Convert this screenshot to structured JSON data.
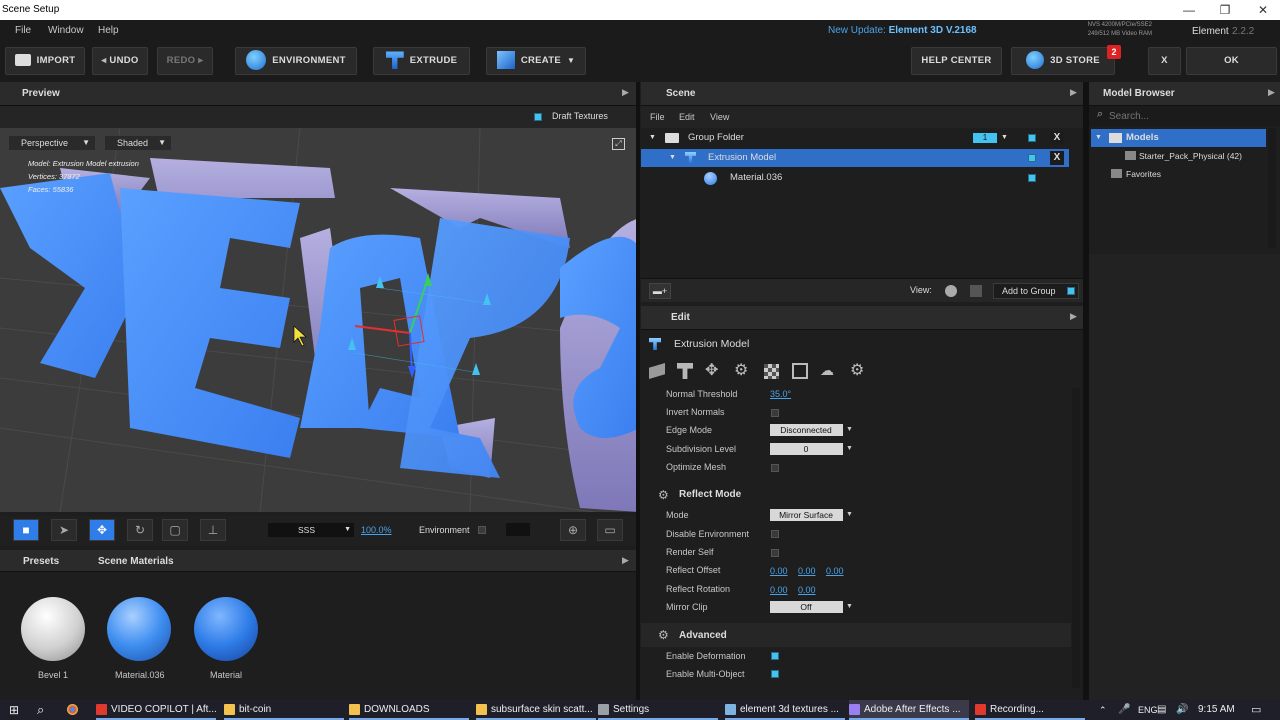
{
  "window": {
    "title": "Scene Setup",
    "controls": {
      "minimize": "—",
      "restore": "❐",
      "close": "✕"
    }
  },
  "menu": [
    "File",
    "Window",
    "Help"
  ],
  "update_prefix": "New Update:",
  "update_version": "Element 3D V.2168",
  "gpu_info": {
    "line1": "NVS 4200M/PCIe/SSE2",
    "line2": "249/512 MB Video RAM"
  },
  "app_name": "Element",
  "app_version": "2.2.2",
  "toolbar": {
    "import": "IMPORT",
    "undo": "UNDO",
    "redo": "REDO",
    "environment": "ENVIRONMENT",
    "extrude": "EXTRUDE",
    "create": "CREATE",
    "help_center": "HELP CENTER",
    "store": "3D STORE",
    "store_badge": "2",
    "close": "X",
    "ok": "OK"
  },
  "preview": {
    "title": "Preview",
    "draft_textures": "Draft Textures",
    "camera": "Perspective",
    "shading": "Shaded",
    "hud": {
      "model": "Model: Extrusion Model extrusion",
      "vertices": "Vertices: 37872",
      "faces": "Faces: 55836"
    }
  },
  "viewport_toolbar": {
    "sampling": "SSS",
    "zoom": "100.0%",
    "environment": "Environment"
  },
  "materials_panel": {
    "tabs": [
      "Presets",
      "Scene Materials"
    ],
    "items": [
      {
        "label": "Bevel 1",
        "color": "#e8e8e8"
      },
      {
        "label": "Material.036",
        "color": "#3e8ef0"
      },
      {
        "label": "Material",
        "color": "#2f7de8"
      }
    ]
  },
  "scene": {
    "title": "Scene",
    "menu": [
      "File",
      "Edit",
      "View"
    ],
    "tree": [
      {
        "label": "Group Folder",
        "group_num": "1"
      },
      {
        "label": "Extrusion Model"
      },
      {
        "label": "Material.036"
      }
    ],
    "view_label": "View:",
    "add_to_group": "Add to Group"
  },
  "model_browser": {
    "title": "Model Browser",
    "search_placeholder": "Search...",
    "items": [
      "Models",
      "Starter_Pack_Physical (42)",
      "Favorites"
    ]
  },
  "edit": {
    "title": "Edit",
    "model_name": "Extrusion Model",
    "props": {
      "normal_threshold": {
        "label": "Normal Threshold",
        "value": "35.0°"
      },
      "invert_normals": {
        "label": "Invert Normals"
      },
      "edge_mode": {
        "label": "Edge Mode",
        "value": "Disconnected"
      },
      "subdivision_level": {
        "label": "Subdivision Level",
        "value": "0"
      },
      "optimize_mesh": {
        "label": "Optimize Mesh"
      }
    },
    "reflect_section": "Reflect Mode",
    "reflect": {
      "mode": {
        "label": "Mode",
        "value": "Mirror Surface"
      },
      "disable_env": {
        "label": "Disable Environment"
      },
      "render_self": {
        "label": "Render Self"
      },
      "reflect_offset": {
        "label": "Reflect Offset",
        "x": "0.00",
        "y": "0.00",
        "z": "0.00"
      },
      "reflect_rotation": {
        "label": "Reflect Rotation",
        "x": "0.00",
        "y": "0.00"
      },
      "mirror_clip": {
        "label": "Mirror Clip",
        "value": "Off"
      }
    },
    "advanced_section": "Advanced",
    "advanced": {
      "enable_deformation": {
        "label": "Enable Deformation"
      },
      "enable_multi_object": {
        "label": "Enable Multi-Object"
      }
    }
  },
  "taskbar": {
    "apps": [
      {
        "label": "VIDEO COPILOT | Aft...",
        "color": "#e03a2e"
      },
      {
        "label": "bit-coin",
        "color": "#f2c14e"
      },
      {
        "label": "DOWNLOADS",
        "color": "#f2c14e"
      },
      {
        "label": "subsurface skin scatt...",
        "color": "#f2c14e"
      },
      {
        "label": "Settings",
        "color": "#9aa0a6"
      },
      {
        "label": "element 3d textures ...",
        "color": "#7fb3e0"
      },
      {
        "label": "Adobe After Effects ...",
        "color": "#9a7ff0"
      },
      {
        "label": "Recording...",
        "color": "#e03a2e"
      }
    ],
    "tray_lang": "ENG",
    "time": "9:15 AM"
  }
}
